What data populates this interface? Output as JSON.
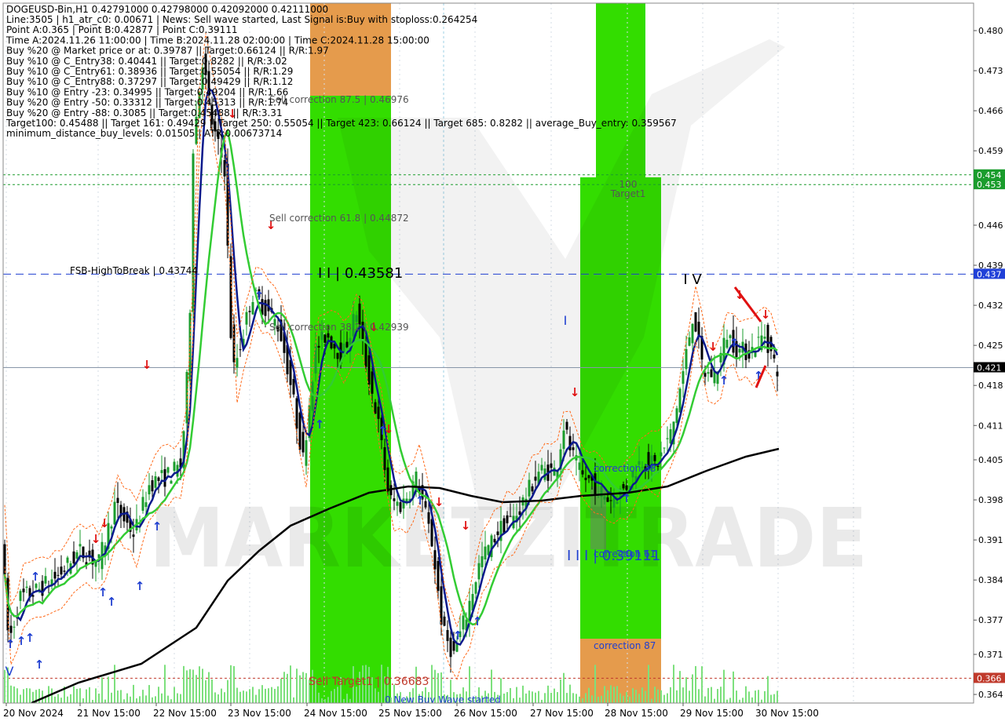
{
  "chart_data": {
    "type": "candlestick",
    "symbol": "DOGEUSD-Bin,H1",
    "header_ohlc": "0.42791000 0.42798000 0.42092000 0.42111000",
    "info_lines": [
      "Line:3505 | h1_atr_c0: 0.00671 | News: Sell wave started, Last Signal is:Buy with stoploss:0.264254",
      "Point A:0.365 | Point B:0.42877 | Point C:0.39111",
      "Time A:2024.11.26 11:00:00 | Time B:2024.11.28 02:00:00 | Time C:2024.11.28 15:00:00",
      "Buy %20 @ Market price or at: 0.39787 || Target:0.66124 || R/R:1.97",
      "Buy %10 @ C_Entry38: 0.40441 || Target:0.8282 || R/R:3.02",
      "Buy %10 @ C_Entry61: 0.38936 || Target:0.55054 || R/R:1.29",
      "Buy %10 @ C_Entry88: 0.37297 || Target:0.49429 || R/R:1.12",
      "Buy %10 @ Entry -23: 0.34995 || Target:0.49204 || R/R:1.66",
      "Buy %20 @ Entry -50: 0.33312 || Target:0.45313 || R/R:1.74",
      "Buy %20 @ Entry -88: 0.3085 || Target:0.45488 || R/R:3.31",
      "Target100: 0.45488 || Target 161: 0.49429 || Target 250: 0.55054 || Target 423: 0.66124 || Target 685: 0.8282 || average_Buy_entry: 0.359567",
      "minimum_distance_buy_levels: 0.01505 | ATR:0.00673714"
    ],
    "y_ticks": [
      "0.480",
      "0.473",
      "0.466",
      "0.459",
      "0.453",
      "0.446",
      "0.439",
      "0.432",
      "0.425",
      "0.418",
      "0.411",
      "0.405",
      "0.398",
      "0.391",
      "0.384",
      "0.377",
      "0.371",
      "0.364"
    ],
    "y_range": [
      0.3625,
      0.4848
    ],
    "x_labels": [
      "20 Nov 2024",
      "21 Nov 15:00",
      "22 Nov 15:00",
      "23 Nov 15:00",
      "24 Nov 15:00",
      "25 Nov 15:00",
      "26 Nov 15:00",
      "27 Nov 15:00",
      "28 Nov 15:00",
      "29 Nov 15:00",
      "30 Nov 15:00"
    ],
    "price_tags": [
      {
        "text": "0.454",
        "value": 0.4548,
        "color": "#1a9c2c"
      },
      {
        "text": "0.453",
        "value": 0.4531,
        "color": "#1a9c2c"
      },
      {
        "text": "0.437",
        "value": 0.43744,
        "color": "#2040d8"
      },
      {
        "text": "0.421",
        "value": 0.42111,
        "color": "#000000"
      },
      {
        "text": "0.366",
        "value": 0.36683,
        "color": "#c0392b"
      }
    ],
    "horizontal_lines": [
      {
        "value": 0.43744,
        "color": "#1f3fd0",
        "dash": "10,6"
      },
      {
        "value": 0.42111,
        "color": "#8896a8",
        "dash": ""
      },
      {
        "value": 0.4548,
        "color": "#1a9c2c",
        "dash": "3,3"
      },
      {
        "value": 0.4531,
        "color": "#1a9c2c",
        "dash": "3,3"
      },
      {
        "value": 0.36683,
        "color": "#c0392b",
        "dash": "3,3"
      }
    ],
    "annotations": [
      {
        "text": "Sell correction 87.5 | 0.46976",
        "color": "#555555"
      },
      {
        "text": "Sell correction 61.8 | 0.44872",
        "color": "#555555"
      },
      {
        "text": "Sell correction 38.2 | 0.42939",
        "color": "#555555"
      },
      {
        "text": "FSB-HighToBreak | 0.43744",
        "color": "#000000"
      },
      {
        "text": "I I | 0.43581",
        "color": "#000000"
      },
      {
        "text": "I I I | 0.39111",
        "color": "#1f3fd0"
      },
      {
        "text": "correction 38",
        "color": "#1f3fd0"
      },
      {
        "text": "correction 61",
        "color": "#1f3fd0"
      },
      {
        "text": "correction 87",
        "color": "#1f3fd0"
      },
      {
        "text": "100",
        "color": "#555555"
      },
      {
        "text": "Target1",
        "color": "#555555"
      },
      {
        "text": "Sell Target1 | 0.36683",
        "color": "#c0392b"
      },
      {
        "text": "0 New Buy Wave started",
        "color": "#1f3fd0"
      },
      {
        "text": "I V",
        "color": "#000000"
      },
      {
        "text": "V",
        "color": "#1f3fd0"
      },
      {
        "text": "I",
        "color": "#1f3fd0"
      }
    ],
    "watermark": "MARKETZITRADE",
    "colors": {
      "bull": "#1a9c2c",
      "bear": "#000000",
      "ma_fast": "#0b1a8c",
      "ma_mid": "#33cc33",
      "ma_slow": "#000000",
      "buy_arrow": "#1f3fd0",
      "sell_arrow": "#e01010",
      "zone_green": "#33dd00",
      "zone_orange": "#e59b4c"
    }
  }
}
